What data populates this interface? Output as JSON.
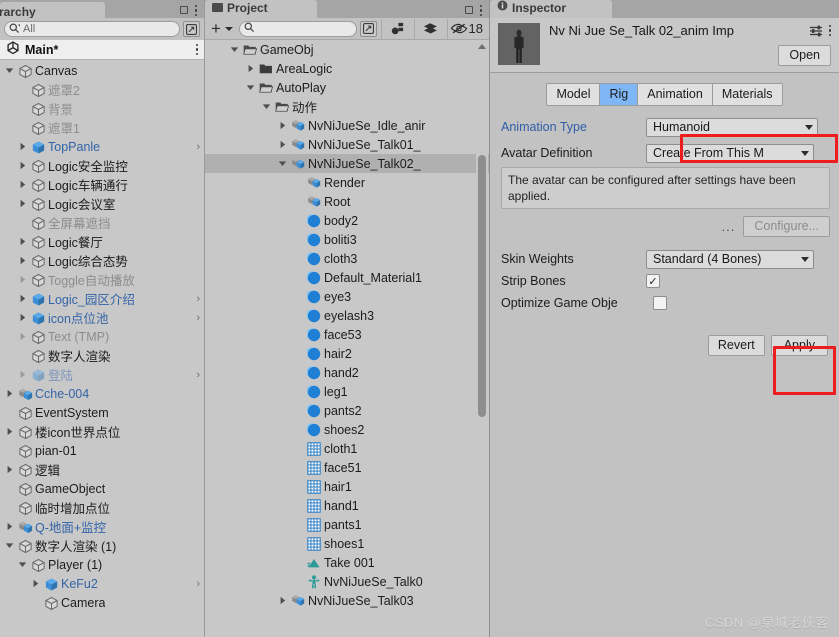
{
  "hierarchy": {
    "tab_label": "rarchy",
    "search": {
      "placeholder": "All",
      "icon": "search-icon"
    },
    "scene_name": "Main*",
    "items": [
      {
        "label": "Canvas",
        "indent": 0,
        "arrow": "down",
        "icon": "gameobject-cube",
        "style": "normal"
      },
      {
        "label": "遮罩2",
        "indent": 1,
        "arrow": "none",
        "icon": "gameobject-cube",
        "style": "dim"
      },
      {
        "label": "背景",
        "indent": 1,
        "arrow": "none",
        "icon": "gameobject-cube",
        "style": "dim"
      },
      {
        "label": "遮罩1",
        "indent": 1,
        "arrow": "none",
        "icon": "gameobject-cube",
        "style": "dim"
      },
      {
        "label": "TopPanle",
        "indent": 1,
        "arrow": "right",
        "icon": "prefab-cube",
        "style": "blue",
        "chevron": ">"
      },
      {
        "label": "Logic安全监控",
        "indent": 1,
        "arrow": "right",
        "icon": "gameobject-cube",
        "style": "normal"
      },
      {
        "label": "Logic车辆通行",
        "indent": 1,
        "arrow": "right",
        "icon": "gameobject-cube",
        "style": "normal"
      },
      {
        "label": "Logic会议室",
        "indent": 1,
        "arrow": "right",
        "icon": "gameobject-cube",
        "style": "normal"
      },
      {
        "label": "全屏幕遮挡",
        "indent": 1,
        "arrow": "none",
        "icon": "gameobject-cube",
        "style": "dim"
      },
      {
        "label": "Logic餐厅",
        "indent": 1,
        "arrow": "right",
        "icon": "gameobject-cube",
        "style": "normal"
      },
      {
        "label": "Logic综合态势",
        "indent": 1,
        "arrow": "right",
        "icon": "gameobject-cube",
        "style": "normal"
      },
      {
        "label": "Toggle自动播放",
        "indent": 1,
        "arrow": "right-dim",
        "icon": "gameobject-cube",
        "style": "dim"
      },
      {
        "label": "Logic_园区介绍",
        "indent": 1,
        "arrow": "right",
        "icon": "prefab-cube",
        "style": "blue",
        "chevron": ">"
      },
      {
        "label": "icon点位池",
        "indent": 1,
        "arrow": "right",
        "icon": "prefab-cube",
        "style": "blue",
        "chevron": ">"
      },
      {
        "label": "Text (TMP)",
        "indent": 1,
        "arrow": "right-dim",
        "icon": "gameobject-cube",
        "style": "dim"
      },
      {
        "label": "数字人渲染",
        "indent": 1,
        "arrow": "none",
        "icon": "gameobject-cube",
        "style": "normal"
      },
      {
        "label": "登陆",
        "indent": 1,
        "arrow": "right-dim",
        "icon": "prefab-cube-dim",
        "style": "blue-dim",
        "chevron": ">"
      },
      {
        "label": "Cche-004",
        "indent": 0,
        "arrow": "right",
        "icon": "prefab-model",
        "style": "blue"
      },
      {
        "label": "EventSystem",
        "indent": 0,
        "arrow": "none",
        "icon": "gameobject-cube",
        "style": "normal"
      },
      {
        "label": "楼icon世界点位",
        "indent": 0,
        "arrow": "right",
        "icon": "gameobject-cube",
        "style": "normal"
      },
      {
        "label": "pian-01",
        "indent": 0,
        "arrow": "none",
        "icon": "gameobject-cube",
        "style": "normal"
      },
      {
        "label": "逻辑",
        "indent": 0,
        "arrow": "right",
        "icon": "gameobject-cube",
        "style": "normal"
      },
      {
        "label": "GameObject",
        "indent": 0,
        "arrow": "none",
        "icon": "gameobject-cube",
        "style": "normal"
      },
      {
        "label": "临时增加点位",
        "indent": 0,
        "arrow": "none",
        "icon": "gameobject-cube",
        "style": "normal"
      },
      {
        "label": "Q-地面+监控",
        "indent": 0,
        "arrow": "right",
        "icon": "prefab-model",
        "style": "blue"
      },
      {
        "label": "数字人渲染 (1)",
        "indent": 0,
        "arrow": "down",
        "icon": "gameobject-cube",
        "style": "normal"
      },
      {
        "label": "Player (1)",
        "indent": 1,
        "arrow": "down",
        "icon": "gameobject-cube",
        "style": "normal"
      },
      {
        "label": "KeFu2",
        "indent": 2,
        "arrow": "right",
        "icon": "prefab-cube",
        "style": "blue",
        "chevron": ">"
      },
      {
        "label": "Camera",
        "indent": 2,
        "arrow": "none",
        "icon": "gameobject-cube",
        "style": "normal"
      }
    ]
  },
  "project": {
    "tab_label": "Project",
    "toolbar": {
      "create_label": "+",
      "search_placeholder": "",
      "hidden_count": "18",
      "icons": [
        "create-dropdown-icon",
        "search-icon",
        "search-expand-icon",
        "avatar-filter-icon",
        "label-filter-icon",
        "hidden-eye-icon"
      ]
    },
    "items": [
      {
        "label": "GameObj",
        "indent": 1,
        "arrow": "down",
        "icon": "folder-open",
        "selected": false
      },
      {
        "label": "AreaLogic",
        "indent": 2,
        "arrow": "right",
        "icon": "folder",
        "selected": false
      },
      {
        "label": "AutoPlay",
        "indent": 2,
        "arrow": "down",
        "icon": "folder-open",
        "selected": false
      },
      {
        "label": "动作",
        "indent": 3,
        "arrow": "down",
        "icon": "folder-open",
        "selected": false
      },
      {
        "label": "NvNiJueSe_Idle_anir",
        "indent": 4,
        "arrow": "right",
        "icon": "model-prefab",
        "selected": false
      },
      {
        "label": "NvNiJueSe_Talk01_",
        "indent": 4,
        "arrow": "right",
        "icon": "model-prefab",
        "selected": false
      },
      {
        "label": "NvNiJueSe_Talk02_",
        "indent": 4,
        "arrow": "down",
        "icon": "model-prefab",
        "selected": true
      },
      {
        "label": "Render",
        "indent": 5,
        "arrow": "none",
        "icon": "model-prefab",
        "selected": false
      },
      {
        "label": "Root",
        "indent": 5,
        "arrow": "none",
        "icon": "model-prefab",
        "selected": false
      },
      {
        "label": "body2",
        "indent": 5,
        "arrow": "none",
        "icon": "material",
        "selected": false
      },
      {
        "label": "boliti3",
        "indent": 5,
        "arrow": "none",
        "icon": "material",
        "selected": false
      },
      {
        "label": "cloth3",
        "indent": 5,
        "arrow": "none",
        "icon": "material",
        "selected": false
      },
      {
        "label": "Default_Material1",
        "indent": 5,
        "arrow": "none",
        "icon": "material",
        "selected": false
      },
      {
        "label": "eye3",
        "indent": 5,
        "arrow": "none",
        "icon": "material",
        "selected": false
      },
      {
        "label": "eyelash3",
        "indent": 5,
        "arrow": "none",
        "icon": "material",
        "selected": false
      },
      {
        "label": "face53",
        "indent": 5,
        "arrow": "none",
        "icon": "material",
        "selected": false
      },
      {
        "label": "hair2",
        "indent": 5,
        "arrow": "none",
        "icon": "material",
        "selected": false
      },
      {
        "label": "hand2",
        "indent": 5,
        "arrow": "none",
        "icon": "material",
        "selected": false
      },
      {
        "label": "leg1",
        "indent": 5,
        "arrow": "none",
        "icon": "material",
        "selected": false
      },
      {
        "label": "pants2",
        "indent": 5,
        "arrow": "none",
        "icon": "material",
        "selected": false
      },
      {
        "label": "shoes2",
        "indent": 5,
        "arrow": "none",
        "icon": "material",
        "selected": false
      },
      {
        "label": "cloth1",
        "indent": 5,
        "arrow": "none",
        "icon": "mesh",
        "selected": false
      },
      {
        "label": "face51",
        "indent": 5,
        "arrow": "none",
        "icon": "mesh",
        "selected": false
      },
      {
        "label": "hair1",
        "indent": 5,
        "arrow": "none",
        "icon": "mesh",
        "selected": false
      },
      {
        "label": "hand1",
        "indent": 5,
        "arrow": "none",
        "icon": "mesh",
        "selected": false
      },
      {
        "label": "pants1",
        "indent": 5,
        "arrow": "none",
        "icon": "mesh",
        "selected": false
      },
      {
        "label": "shoes1",
        "indent": 5,
        "arrow": "none",
        "icon": "mesh",
        "selected": false
      },
      {
        "label": "Take 001",
        "indent": 5,
        "arrow": "none",
        "icon": "animation",
        "selected": false
      },
      {
        "label": "NvNiJueSe_Talk0",
        "indent": 5,
        "arrow": "none",
        "icon": "avatar",
        "selected": false
      },
      {
        "label": "NvNiJueSe_Talk03",
        "indent": 4,
        "arrow": "right",
        "icon": "model-prefab",
        "selected": false
      }
    ]
  },
  "inspector": {
    "tab_label": "Inspector",
    "asset_title": "Nv Ni Jue Se_Talk 02_anim Imp",
    "open_button": "Open",
    "tabs": [
      {
        "label": "Model",
        "active": false
      },
      {
        "label": "Rig",
        "active": true
      },
      {
        "label": "Animation",
        "active": false
      },
      {
        "label": "Materials",
        "active": false
      }
    ],
    "fields": {
      "animation_type_label": "Animation Type",
      "animation_type_value": "Humanoid",
      "avatar_definition_label": "Avatar Definition",
      "avatar_definition_value": "Create From This M",
      "help_text": "The avatar can be configured after settings have been applied.",
      "configure_dots": "...",
      "configure_button": "Configure...",
      "skin_weights_label": "Skin Weights",
      "skin_weights_value": "Standard (4 Bones)",
      "strip_bones_label": "Strip Bones",
      "strip_bones_checked": "✓",
      "optimize_label": "Optimize Game Obje",
      "optimize_checked": ""
    },
    "actions": {
      "revert": "Revert",
      "apply": "Apply"
    }
  },
  "watermark": "CSDN @泉城老侠客",
  "colors": {
    "accent_blue": "#7fb6f5",
    "link_blue": "#2f5fa8",
    "highlight_red": "#ee1c1c",
    "panel_bg": "#c8c8c8",
    "toolbar_bg": "#c2c2c2",
    "tabstrip_bg": "#a5a5a5"
  }
}
